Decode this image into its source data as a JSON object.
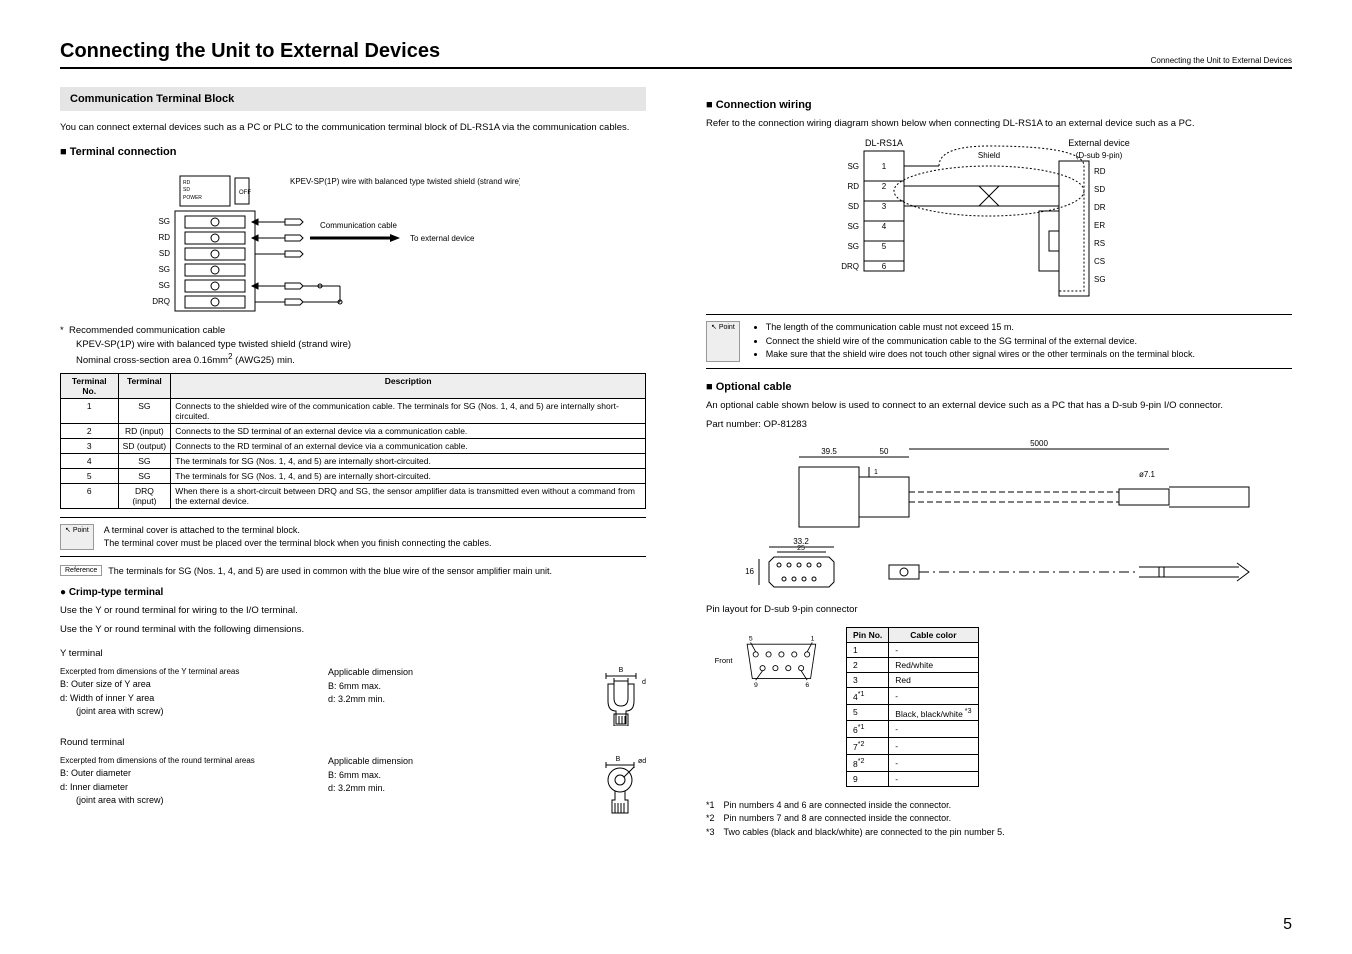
{
  "page_title": "Connecting the Unit to External Devices",
  "header_right": "Connecting the Unit to External Devices",
  "page_number": "5",
  "left": {
    "section_bar": "Communication Terminal Block",
    "intro": "You can connect external devices such as a PC or PLC to the communication terminal block of DL-RS1A via the communication cables.",
    "terminal_connection": "Terminal connection",
    "diagram": {
      "labels": [
        "SG",
        "RD",
        "SD",
        "SG",
        "SG",
        "DRQ"
      ],
      "note1": "KPEV-SP(1P) wire with balanced type twisted shield (strand wire)",
      "note2": "Communication cable",
      "note3": "To external device"
    },
    "rec_cable_star": "*",
    "rec_cable_title": "Recommended communication cable",
    "rec_cable_line1": "KPEV-SP(1P) wire with balanced type twisted shield (strand wire)",
    "rec_cable_line2_a": "Nominal cross-section area 0.16mm",
    "rec_cable_line2_b": " (AWG25) min.",
    "terminal_table": {
      "headers": [
        "Terminal No.",
        "Terminal",
        "Description"
      ],
      "rows": [
        {
          "no": "1",
          "term": "SG",
          "desc": "Connects to the shielded wire of the communication cable.\nThe terminals for SG (Nos. 1, 4, and 5) are internally short-circuited."
        },
        {
          "no": "2",
          "term": "RD (input)",
          "desc": "Connects to the SD terminal of an external device via a communication cable."
        },
        {
          "no": "3",
          "term": "SD (output)",
          "desc": "Connects to the RD terminal of an external device via a communication cable."
        },
        {
          "no": "4",
          "term": "SG",
          "desc": "The terminals for SG (Nos. 1, 4, and 5) are internally short-circuited."
        },
        {
          "no": "5",
          "term": "SG",
          "desc": "The terminals for SG (Nos. 1, 4, and 5) are internally short-circuited."
        },
        {
          "no": "6",
          "term": "DRQ (input)",
          "desc": "When there is a short-circuit between DRQ and SG, the sensor amplifier data is transmitted even without a command from the external device."
        }
      ]
    },
    "point_label": "Point",
    "point_text1": "A terminal cover is attached to the terminal block.",
    "point_text2": "The terminal cover must be placed over the terminal block when you finish connecting the cables.",
    "reference_label": "Reference",
    "reference_text": "The terminals for SG (Nos. 1, 4, and 5) are used in common with the blue wire of the sensor amplifier main unit.",
    "crimp_heading": "Crimp-type terminal",
    "crimp_line1": "Use the Y or round terminal for wiring to the I/O terminal.",
    "crimp_line2": "Use the Y or round terminal with the following dimensions.",
    "y_terminal": {
      "title": "Y terminal",
      "excerpt": "Excerpted from dimensions of the Y terminal areas",
      "b_label": "B: Outer size of Y area",
      "d_label": "d: Width of inner Y area",
      "joint": "(joint area with screw)",
      "applicable": "Applicable dimension",
      "b_val": "B: 6mm max.",
      "d_val": "d: 3.2mm min."
    },
    "round_terminal": {
      "title": "Round terminal",
      "excerpt": "Excerpted from dimensions of the round terminal areas",
      "b_label": "B: Outer diameter",
      "d_label": "d: Inner diameter",
      "joint": "(joint area with screw)",
      "applicable": "Applicable dimension",
      "b_val": "B: 6mm max.",
      "d_val": "d: 3.2mm min."
    }
  },
  "right": {
    "connection_wiring": "Connection wiring",
    "wiring_intro": "Refer to the connection wiring diagram shown below when connecting DL-RS1A to an external device such as a PC.",
    "wiring": {
      "left_title": "DL-RS1A",
      "left_labels": [
        "SG",
        "RD",
        "SD",
        "SG",
        "SG",
        "DRQ"
      ],
      "left_nums": [
        "1",
        "2",
        "3",
        "4",
        "5",
        "6"
      ],
      "shield": "Shield",
      "right_title": "External device",
      "right_sub": "(D-sub 9-pin)",
      "right_labels": [
        "RD",
        "SD",
        "DR",
        "ER",
        "RS",
        "CS",
        "SG"
      ]
    },
    "point_label": "Point",
    "point_bullets": [
      "The length of the communication cable must not exceed 15 m.",
      "Connect the shield wire of the communication cable to the SG terminal of the external device.",
      "Make sure that the shield wire does not touch other signal wires or the other terminals on the terminal block."
    ],
    "optional_cable": "Optional cable",
    "optional_intro": "An optional cable shown below is used to connect to an external device such as a PC that has a D-sub 9-pin I/O connector.",
    "part_number": "Part number: OP-81283",
    "cable_dims": {
      "d1": "39.5",
      "d2": "50",
      "d3": "5000",
      "d4": "ø7.1",
      "d5": "33.2",
      "d6": "25",
      "d7": "16",
      "d8": "1"
    },
    "pin_layout_title": "Pin layout for D-sub 9-pin connector",
    "dsub": {
      "front": "Front",
      "p5": "5",
      "p1": "1",
      "p9": "9",
      "p6": "6"
    },
    "cable_table": {
      "headers": [
        "Pin No.",
        "Cable color"
      ],
      "rows": [
        {
          "no": "1",
          "color": "-"
        },
        {
          "no": "2",
          "color": "Red/white"
        },
        {
          "no": "3",
          "color": "Red"
        },
        {
          "no": "4",
          "sup": "*1",
          "color": "-"
        },
        {
          "no": "5",
          "color": "Black, black/white",
          "color_sup": "*3"
        },
        {
          "no": "6",
          "sup": "*1",
          "color": "-"
        },
        {
          "no": "7",
          "sup": "*2",
          "color": "-"
        },
        {
          "no": "8",
          "sup": "*2",
          "color": "-"
        },
        {
          "no": "9",
          "color": "-"
        }
      ]
    },
    "footnotes": [
      {
        "mark": "*1",
        "text": "Pin numbers 4 and 6 are connected inside the connector."
      },
      {
        "mark": "*2",
        "text": "Pin numbers 7 and 8 are connected inside the connector."
      },
      {
        "mark": "*3",
        "text": "Two cables (black and black/white) are connected to the pin number 5."
      }
    ]
  }
}
